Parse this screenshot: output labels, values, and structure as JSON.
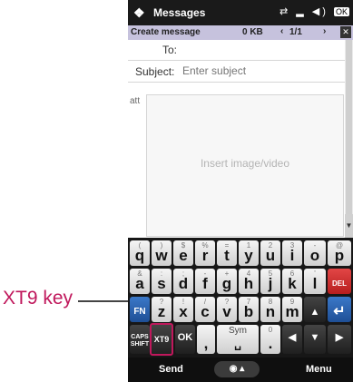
{
  "callout": {
    "label": "XT9 key"
  },
  "status_bar": {
    "logo": "❖",
    "title": "Messages",
    "icons": "⇄ ▂ ◀) ",
    "ok": "OK"
  },
  "subheader": {
    "title": "Create message",
    "size": "0 KB",
    "nav_left": "‹",
    "page": "1/1",
    "nav_right": "›",
    "close": "✕"
  },
  "compose": {
    "to_label": "To:",
    "subject_label": "Subject:",
    "subject_placeholder": "Enter subject",
    "attach_label": "att",
    "media_placeholder": "Insert image/video"
  },
  "keyboard": {
    "row1": [
      {
        "main": "q",
        "sub": "("
      },
      {
        "main": "w",
        "sub": ")"
      },
      {
        "main": "e",
        "sub": "$"
      },
      {
        "main": "r",
        "sub": "%"
      },
      {
        "main": "t",
        "sub": "="
      },
      {
        "main": "y",
        "sub": "1"
      },
      {
        "main": "u",
        "sub": "2"
      },
      {
        "main": "i",
        "sub": "3"
      },
      {
        "main": "o",
        "sub": "-"
      },
      {
        "main": "p",
        "sub": "@"
      }
    ],
    "row2": [
      {
        "main": "a",
        "sub": "&"
      },
      {
        "main": "s",
        "sub": ":"
      },
      {
        "main": "d",
        "sub": ";"
      },
      {
        "main": "f",
        "sub": "-"
      },
      {
        "main": "g",
        "sub": "+"
      },
      {
        "main": "h",
        "sub": "4"
      },
      {
        "main": "j",
        "sub": "5"
      },
      {
        "main": "k",
        "sub": "6"
      },
      {
        "main": "l",
        "sub": "'"
      }
    ],
    "del": "DEL",
    "row3": [
      {
        "main": "z",
        "sub": "?"
      },
      {
        "main": "x",
        "sub": "!"
      },
      {
        "main": "c",
        "sub": "/"
      },
      {
        "main": "v",
        "sub": "?"
      },
      {
        "main": "b",
        "sub": "7"
      },
      {
        "main": "n",
        "sub": "8"
      },
      {
        "main": "m",
        "sub": "9"
      }
    ],
    "fn": "FN",
    "up_arrow": "▲",
    "enter": "↵",
    "caps": "CAPS SHIFT",
    "xt9": "XT9",
    "ok": "OK",
    "comma": ",",
    "sym": "Sym",
    "zero": "0",
    "period": ".",
    "left_arrow": "◀",
    "down_arrow": "▼",
    "right_arrow": "▶"
  },
  "softkeys": {
    "left": "Send",
    "center": "◉ ▴",
    "right": "Menu"
  }
}
